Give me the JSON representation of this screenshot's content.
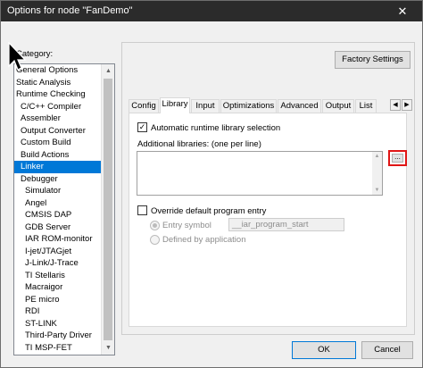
{
  "window": {
    "title": "Options for node \"FanDemo\"",
    "close_glyph": "✕"
  },
  "category": {
    "label": "Category:",
    "items": [
      {
        "label": "General Options",
        "level": 0,
        "selected": false
      },
      {
        "label": "Static Analysis",
        "level": 0,
        "selected": false
      },
      {
        "label": "Runtime Checking",
        "level": 0,
        "selected": false
      },
      {
        "label": "C/C++ Compiler",
        "level": 1,
        "selected": false
      },
      {
        "label": "Assembler",
        "level": 1,
        "selected": false
      },
      {
        "label": "Output Converter",
        "level": 1,
        "selected": false
      },
      {
        "label": "Custom Build",
        "level": 1,
        "selected": false
      },
      {
        "label": "Build Actions",
        "level": 1,
        "selected": false
      },
      {
        "label": "Linker",
        "level": 1,
        "selected": true
      },
      {
        "label": "Debugger",
        "level": 1,
        "selected": false
      },
      {
        "label": "Simulator",
        "level": 2,
        "selected": false
      },
      {
        "label": "Angel",
        "level": 2,
        "selected": false
      },
      {
        "label": "CMSIS DAP",
        "level": 2,
        "selected": false
      },
      {
        "label": "GDB Server",
        "level": 2,
        "selected": false
      },
      {
        "label": "IAR ROM-monitor",
        "level": 2,
        "selected": false
      },
      {
        "label": "I-jet/JTAGjet",
        "level": 2,
        "selected": false
      },
      {
        "label": "J-Link/J-Trace",
        "level": 2,
        "selected": false
      },
      {
        "label": "TI Stellaris",
        "level": 2,
        "selected": false
      },
      {
        "label": "Macraigor",
        "level": 2,
        "selected": false
      },
      {
        "label": "PE micro",
        "level": 2,
        "selected": false
      },
      {
        "label": "RDI",
        "level": 2,
        "selected": false
      },
      {
        "label": "ST-LINK",
        "level": 2,
        "selected": false
      },
      {
        "label": "Third-Party Driver",
        "level": 2,
        "selected": false
      },
      {
        "label": "TI MSP-FET",
        "level": 2,
        "selected": false
      }
    ]
  },
  "buttons": {
    "factory": "Factory Settings",
    "ok": "OK",
    "cancel": "Cancel",
    "browse": "..."
  },
  "tabs": [
    {
      "label": "Config",
      "active": false
    },
    {
      "label": "Library",
      "active": true
    },
    {
      "label": "Input",
      "active": false
    },
    {
      "label": "Optimizations",
      "active": false
    },
    {
      "label": "Advanced",
      "active": false
    },
    {
      "label": "Output",
      "active": false
    },
    {
      "label": "List",
      "active": false
    }
  ],
  "tab_scroll": {
    "left": "◀",
    "right": "▶"
  },
  "library": {
    "auto_runtime": {
      "label": "Automatic runtime library selection",
      "checked": true
    },
    "additional_label": "Additional libraries: (one per line)",
    "additional_value": "",
    "override_entry": {
      "label": "Override default program entry",
      "checked": false
    },
    "entry_symbol": {
      "label": "Entry symbol",
      "value": "__iar_program_start",
      "selected": true
    },
    "defined_by_app": {
      "label": "Defined by application",
      "selected": false
    }
  },
  "icons": {
    "check": "✓",
    "up": "▲",
    "down": "▼"
  },
  "colors": {
    "selection": "#0078d7",
    "highlight_box": "#e01515",
    "titlebar": "#2b2b2b"
  }
}
